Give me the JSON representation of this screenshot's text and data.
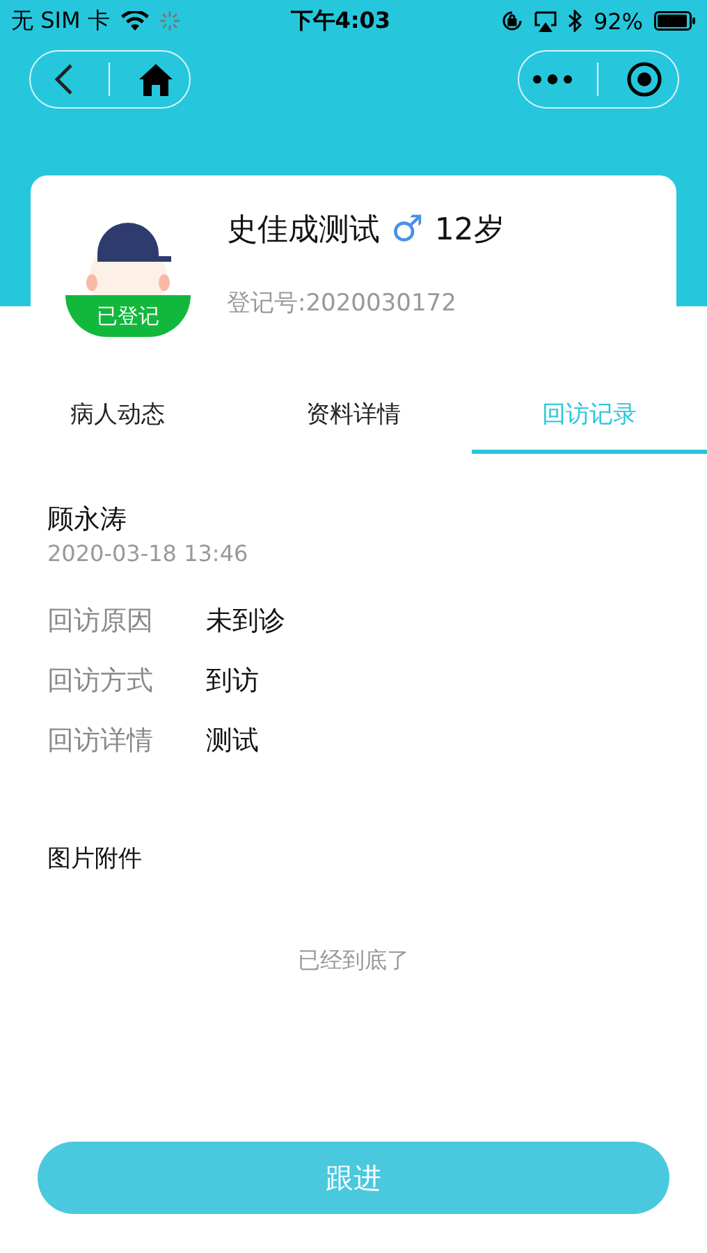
{
  "status_bar": {
    "carrier": "无 SIM 卡",
    "time": "下午4:03",
    "battery": "92%"
  },
  "patient": {
    "name": "史佳成测试",
    "gender_symbol": "♂",
    "age": "12岁",
    "badge": "已登记",
    "record_no": "登记号:2020030172"
  },
  "tabs": [
    {
      "label": "病人动态",
      "selected": false
    },
    {
      "label": "资料详情",
      "selected": false
    },
    {
      "label": "回访记录",
      "selected": true
    }
  ],
  "visit": {
    "visitor": "顾永涛",
    "time": "2020-03-18 13:46",
    "fields": [
      {
        "label": "回访原因",
        "value": "未到诊"
      },
      {
        "label": "回访方式",
        "value": "到访"
      },
      {
        "label": "回访详情",
        "value": "测试"
      }
    ]
  },
  "attachments_title": "图片附件",
  "end_note": "已经到底了",
  "action_button": "跟进"
}
